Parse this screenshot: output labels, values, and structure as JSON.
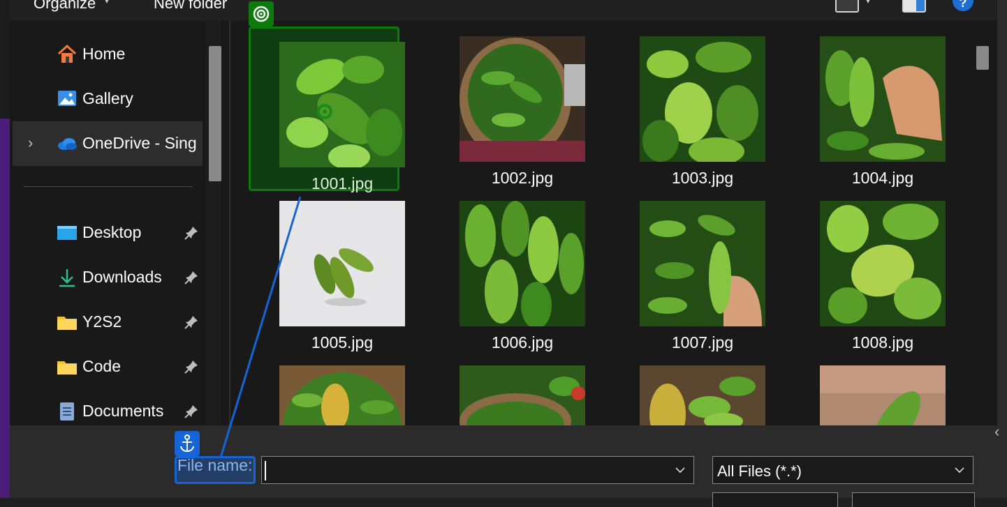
{
  "toolbar": {
    "organize_label": "Organize",
    "new_folder_label": "New folder",
    "help_label": "?"
  },
  "sidebar": {
    "items": [
      {
        "label": "Home",
        "icon": "home-icon"
      },
      {
        "label": "Gallery",
        "icon": "gallery-icon"
      },
      {
        "label": "OneDrive - Sing",
        "icon": "onedrive-cloud-icon"
      },
      {
        "label": "Desktop",
        "icon": "desktop-icon",
        "pinned": true
      },
      {
        "label": "Downloads",
        "icon": "download-icon",
        "pinned": true
      },
      {
        "label": "Y2S2",
        "icon": "folder-icon",
        "pinned": true
      },
      {
        "label": "Code",
        "icon": "folder-icon",
        "pinned": true
      },
      {
        "label": "Documents",
        "icon": "documents-icon",
        "pinned": true
      }
    ]
  },
  "files": [
    {
      "name": "1001.jpg",
      "selected": true
    },
    {
      "name": "1002.jpg"
    },
    {
      "name": "1003.jpg"
    },
    {
      "name": "1004.jpg"
    },
    {
      "name": "1005.jpg"
    },
    {
      "name": "1006.jpg"
    },
    {
      "name": "1007.jpg"
    },
    {
      "name": "1008.jpg"
    },
    {
      "name": ""
    },
    {
      "name": ""
    },
    {
      "name": ""
    },
    {
      "name": ""
    }
  ],
  "bottom": {
    "file_name_label": "File name:",
    "file_name_value": "",
    "file_type_value": "All Files (*.*)"
  },
  "colors": {
    "accent_green": "#0e7a0e",
    "accent_blue": "#1565d8",
    "background": "#191919"
  }
}
